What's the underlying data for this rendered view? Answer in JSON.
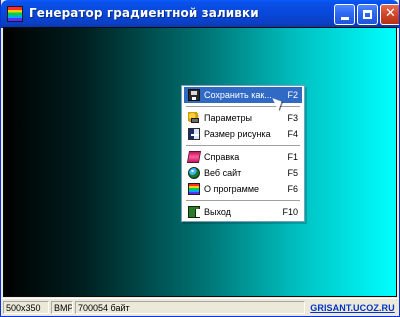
{
  "window": {
    "title": "Генератор градиентной заливки",
    "app_icon": "gradient-app-icon",
    "controls": {
      "minimize_icon": "minimize-icon",
      "maximize_icon": "maximize-icon",
      "close_icon": "close-icon"
    }
  },
  "context_menu": {
    "items": [
      {
        "label": "Сохранить как...",
        "shortcut": "F2",
        "icon": "save-disk-icon"
      },
      {
        "label": "Параметры",
        "shortcut": "F3",
        "icon": "settings-icon"
      },
      {
        "label": "Размер рисунка",
        "shortcut": "F4",
        "icon": "image-size-icon"
      },
      {
        "label": "Справка",
        "shortcut": "F1",
        "icon": "help-book-icon"
      },
      {
        "label": "Веб сайт",
        "shortcut": "F5",
        "icon": "website-globe-icon"
      },
      {
        "label": "О программе",
        "shortcut": "F6",
        "icon": "about-app-icon"
      },
      {
        "label": "Выход",
        "shortcut": "F10",
        "icon": "exit-icon"
      }
    ]
  },
  "statusbar": {
    "dimensions": "500x350",
    "format": "BMP",
    "file_size": "700054 байт",
    "link": "GRISANT.UCOZ.RU"
  }
}
